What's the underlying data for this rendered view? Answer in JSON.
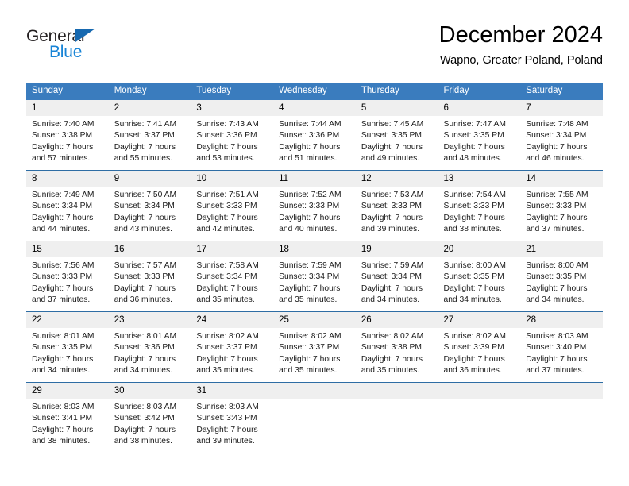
{
  "brand": {
    "name_part1": "General",
    "name_part2": "Blue",
    "triangle_color": "#1769b0",
    "blue_color": "#1884d6"
  },
  "header": {
    "title": "December 2024",
    "subtitle": "Wapno, Greater Poland, Poland"
  },
  "theme": {
    "header_row_bg": "#3a7cbe",
    "week_separator": "#2e6da4",
    "daynum_bg": "#efefef"
  },
  "calendar": {
    "weekday_headers": [
      "Sunday",
      "Monday",
      "Tuesday",
      "Wednesday",
      "Thursday",
      "Friday",
      "Saturday"
    ],
    "weeks": [
      {
        "days": [
          {
            "num": "1",
            "sunrise": "Sunrise: 7:40 AM",
            "sunset": "Sunset: 3:38 PM",
            "daylight_line1": "Daylight: 7 hours",
            "daylight_line2": "and 57 minutes."
          },
          {
            "num": "2",
            "sunrise": "Sunrise: 7:41 AM",
            "sunset": "Sunset: 3:37 PM",
            "daylight_line1": "Daylight: 7 hours",
            "daylight_line2": "and 55 minutes."
          },
          {
            "num": "3",
            "sunrise": "Sunrise: 7:43 AM",
            "sunset": "Sunset: 3:36 PM",
            "daylight_line1": "Daylight: 7 hours",
            "daylight_line2": "and 53 minutes."
          },
          {
            "num": "4",
            "sunrise": "Sunrise: 7:44 AM",
            "sunset": "Sunset: 3:36 PM",
            "daylight_line1": "Daylight: 7 hours",
            "daylight_line2": "and 51 minutes."
          },
          {
            "num": "5",
            "sunrise": "Sunrise: 7:45 AM",
            "sunset": "Sunset: 3:35 PM",
            "daylight_line1": "Daylight: 7 hours",
            "daylight_line2": "and 49 minutes."
          },
          {
            "num": "6",
            "sunrise": "Sunrise: 7:47 AM",
            "sunset": "Sunset: 3:35 PM",
            "daylight_line1": "Daylight: 7 hours",
            "daylight_line2": "and 48 minutes."
          },
          {
            "num": "7",
            "sunrise": "Sunrise: 7:48 AM",
            "sunset": "Sunset: 3:34 PM",
            "daylight_line1": "Daylight: 7 hours",
            "daylight_line2": "and 46 minutes."
          }
        ]
      },
      {
        "days": [
          {
            "num": "8",
            "sunrise": "Sunrise: 7:49 AM",
            "sunset": "Sunset: 3:34 PM",
            "daylight_line1": "Daylight: 7 hours",
            "daylight_line2": "and 44 minutes."
          },
          {
            "num": "9",
            "sunrise": "Sunrise: 7:50 AM",
            "sunset": "Sunset: 3:34 PM",
            "daylight_line1": "Daylight: 7 hours",
            "daylight_line2": "and 43 minutes."
          },
          {
            "num": "10",
            "sunrise": "Sunrise: 7:51 AM",
            "sunset": "Sunset: 3:33 PM",
            "daylight_line1": "Daylight: 7 hours",
            "daylight_line2": "and 42 minutes."
          },
          {
            "num": "11",
            "sunrise": "Sunrise: 7:52 AM",
            "sunset": "Sunset: 3:33 PM",
            "daylight_line1": "Daylight: 7 hours",
            "daylight_line2": "and 40 minutes."
          },
          {
            "num": "12",
            "sunrise": "Sunrise: 7:53 AM",
            "sunset": "Sunset: 3:33 PM",
            "daylight_line1": "Daylight: 7 hours",
            "daylight_line2": "and 39 minutes."
          },
          {
            "num": "13",
            "sunrise": "Sunrise: 7:54 AM",
            "sunset": "Sunset: 3:33 PM",
            "daylight_line1": "Daylight: 7 hours",
            "daylight_line2": "and 38 minutes."
          },
          {
            "num": "14",
            "sunrise": "Sunrise: 7:55 AM",
            "sunset": "Sunset: 3:33 PM",
            "daylight_line1": "Daylight: 7 hours",
            "daylight_line2": "and 37 minutes."
          }
        ]
      },
      {
        "days": [
          {
            "num": "15",
            "sunrise": "Sunrise: 7:56 AM",
            "sunset": "Sunset: 3:33 PM",
            "daylight_line1": "Daylight: 7 hours",
            "daylight_line2": "and 37 minutes."
          },
          {
            "num": "16",
            "sunrise": "Sunrise: 7:57 AM",
            "sunset": "Sunset: 3:33 PM",
            "daylight_line1": "Daylight: 7 hours",
            "daylight_line2": "and 36 minutes."
          },
          {
            "num": "17",
            "sunrise": "Sunrise: 7:58 AM",
            "sunset": "Sunset: 3:34 PM",
            "daylight_line1": "Daylight: 7 hours",
            "daylight_line2": "and 35 minutes."
          },
          {
            "num": "18",
            "sunrise": "Sunrise: 7:59 AM",
            "sunset": "Sunset: 3:34 PM",
            "daylight_line1": "Daylight: 7 hours",
            "daylight_line2": "and 35 minutes."
          },
          {
            "num": "19",
            "sunrise": "Sunrise: 7:59 AM",
            "sunset": "Sunset: 3:34 PM",
            "daylight_line1": "Daylight: 7 hours",
            "daylight_line2": "and 34 minutes."
          },
          {
            "num": "20",
            "sunrise": "Sunrise: 8:00 AM",
            "sunset": "Sunset: 3:35 PM",
            "daylight_line1": "Daylight: 7 hours",
            "daylight_line2": "and 34 minutes."
          },
          {
            "num": "21",
            "sunrise": "Sunrise: 8:00 AM",
            "sunset": "Sunset: 3:35 PM",
            "daylight_line1": "Daylight: 7 hours",
            "daylight_line2": "and 34 minutes."
          }
        ]
      },
      {
        "days": [
          {
            "num": "22",
            "sunrise": "Sunrise: 8:01 AM",
            "sunset": "Sunset: 3:35 PM",
            "daylight_line1": "Daylight: 7 hours",
            "daylight_line2": "and 34 minutes."
          },
          {
            "num": "23",
            "sunrise": "Sunrise: 8:01 AM",
            "sunset": "Sunset: 3:36 PM",
            "daylight_line1": "Daylight: 7 hours",
            "daylight_line2": "and 34 minutes."
          },
          {
            "num": "24",
            "sunrise": "Sunrise: 8:02 AM",
            "sunset": "Sunset: 3:37 PM",
            "daylight_line1": "Daylight: 7 hours",
            "daylight_line2": "and 35 minutes."
          },
          {
            "num": "25",
            "sunrise": "Sunrise: 8:02 AM",
            "sunset": "Sunset: 3:37 PM",
            "daylight_line1": "Daylight: 7 hours",
            "daylight_line2": "and 35 minutes."
          },
          {
            "num": "26",
            "sunrise": "Sunrise: 8:02 AM",
            "sunset": "Sunset: 3:38 PM",
            "daylight_line1": "Daylight: 7 hours",
            "daylight_line2": "and 35 minutes."
          },
          {
            "num": "27",
            "sunrise": "Sunrise: 8:02 AM",
            "sunset": "Sunset: 3:39 PM",
            "daylight_line1": "Daylight: 7 hours",
            "daylight_line2": "and 36 minutes."
          },
          {
            "num": "28",
            "sunrise": "Sunrise: 8:03 AM",
            "sunset": "Sunset: 3:40 PM",
            "daylight_line1": "Daylight: 7 hours",
            "daylight_line2": "and 37 minutes."
          }
        ]
      },
      {
        "days": [
          {
            "num": "29",
            "sunrise": "Sunrise: 8:03 AM",
            "sunset": "Sunset: 3:41 PM",
            "daylight_line1": "Daylight: 7 hours",
            "daylight_line2": "and 38 minutes."
          },
          {
            "num": "30",
            "sunrise": "Sunrise: 8:03 AM",
            "sunset": "Sunset: 3:42 PM",
            "daylight_line1": "Daylight: 7 hours",
            "daylight_line2": "and 38 minutes."
          },
          {
            "num": "31",
            "sunrise": "Sunrise: 8:03 AM",
            "sunset": "Sunset: 3:43 PM",
            "daylight_line1": "Daylight: 7 hours",
            "daylight_line2": "and 39 minutes."
          },
          {
            "num": "",
            "sunrise": "",
            "sunset": "",
            "daylight_line1": "",
            "daylight_line2": ""
          },
          {
            "num": "",
            "sunrise": "",
            "sunset": "",
            "daylight_line1": "",
            "daylight_line2": ""
          },
          {
            "num": "",
            "sunrise": "",
            "sunset": "",
            "daylight_line1": "",
            "daylight_line2": ""
          },
          {
            "num": "",
            "sunrise": "",
            "sunset": "",
            "daylight_line1": "",
            "daylight_line2": ""
          }
        ]
      }
    ]
  }
}
